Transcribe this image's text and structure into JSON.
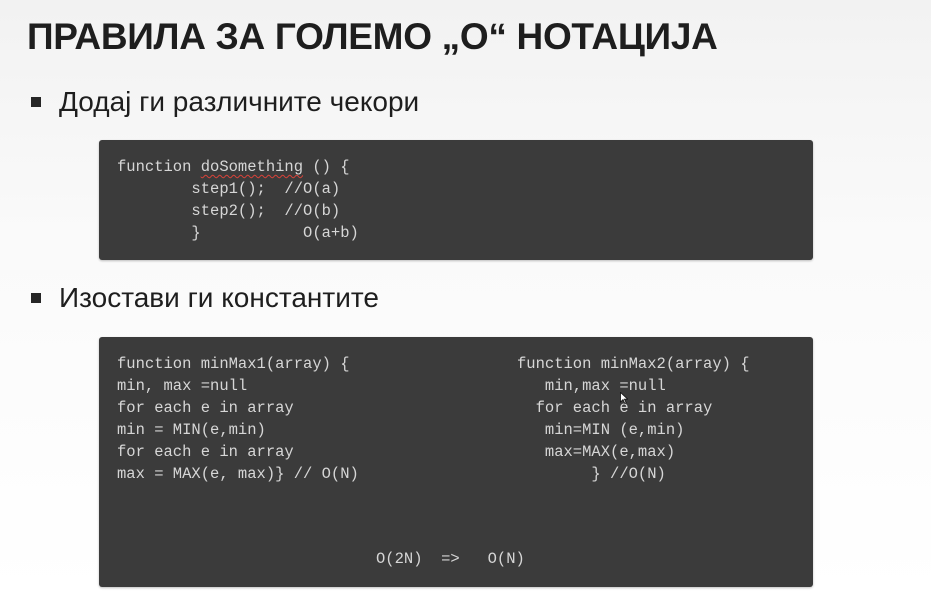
{
  "slide": {
    "title": "ПРАВИЛА ЗА ГОЛЕМО „О“ НОТАЦИЈА",
    "bullets": [
      "Додај ги различните чекори",
      "Изостави ги константите"
    ]
  },
  "code_block_1": {
    "line1_prefix": "function ",
    "line1_func": "doSomething",
    "line1_suffix": " () {",
    "line2": "        step1();  //O(a)",
    "line3": "        step2();  //O(b)",
    "line4": "        }           O(a+b)"
  },
  "code_block_2": {
    "left": [
      "function minMax1(array) {",
      "min, max =null",
      "for each e in array",
      "min = MIN(e,min)",
      "for each e in array",
      "max = MAX(e, max)} // O(N)"
    ],
    "right": [
      "function minMax2(array) {",
      "   min,max =null",
      "  for each e in array",
      "   min=MIN (e,min)",
      "   max=MAX(e,max)",
      "        } //O(N)"
    ],
    "summary": "O(2N)  =>   O(N)"
  },
  "icons": {
    "bullet": "square-bullet-icon",
    "cursor": "mouse-pointer-icon"
  },
  "colors": {
    "code_background": "#3b3b3b",
    "code_text": "#d6d6d6",
    "spellcheck_underline": "#d9423a",
    "title_text": "#1e1e1e"
  }
}
